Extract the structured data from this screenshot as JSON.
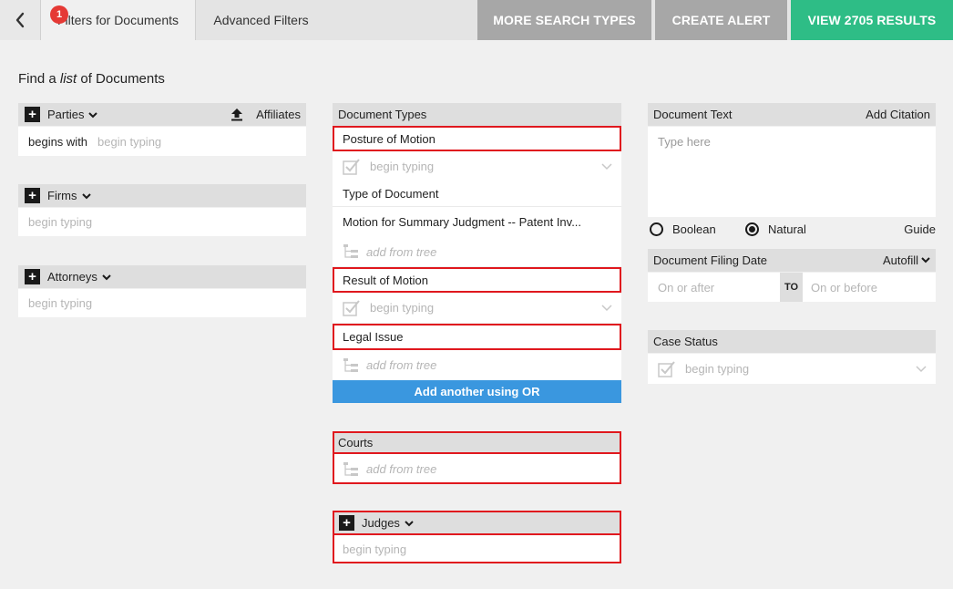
{
  "topbar": {
    "tabs": [
      {
        "label": "Filters for Documents",
        "badge": "1"
      },
      {
        "label": "Advanced Filters"
      }
    ],
    "buttons": {
      "more_search_types": "MORE SEARCH TYPES",
      "create_alert": "CREATE ALERT",
      "view_results": "VIEW 2705 RESULTS"
    },
    "colors": {
      "gray_button": "#a7a7a7",
      "green_button": "#2ebd86",
      "badge": "#e53935"
    }
  },
  "heading": {
    "prefix": "Find a ",
    "emphasis": "list",
    "suffix": " of Documents"
  },
  "left": {
    "parties": {
      "label": "Parties",
      "affiliates": "Affiliates",
      "mode": "begins with",
      "placeholder": "begin typing"
    },
    "firms": {
      "label": "Firms",
      "placeholder": "begin typing"
    },
    "attorneys": {
      "label": "Attorneys",
      "placeholder": "begin typing"
    }
  },
  "middle": {
    "document_types": {
      "header": "Document Types",
      "posture_label": "Posture of Motion",
      "posture_placeholder": "begin typing",
      "type_label": "Type of Document",
      "type_value": "Motion for Summary Judgment -- Patent Inv...",
      "type_tree": "add from tree",
      "result_label": "Result of Motion",
      "result_placeholder": "begin typing",
      "legal_label": "Legal Issue",
      "legal_tree": "add from tree",
      "add_or": "Add another using OR"
    },
    "courts": {
      "header": "Courts",
      "tree": "add from tree"
    },
    "judges": {
      "label": "Judges",
      "placeholder": "begin typing"
    }
  },
  "right": {
    "document_text": {
      "header": "Document Text",
      "add_citation": "Add Citation",
      "placeholder": "Type here",
      "mode_boolean": "Boolean",
      "mode_natural": "Natural",
      "selected_mode": "Natural",
      "guide": "Guide"
    },
    "filing_date": {
      "header": "Document Filing Date",
      "autofill": "Autofill",
      "from_placeholder": "On or after",
      "to_label": "TO",
      "to_placeholder": "On or before"
    },
    "case_status": {
      "header": "Case Status",
      "placeholder": "begin typing"
    }
  }
}
